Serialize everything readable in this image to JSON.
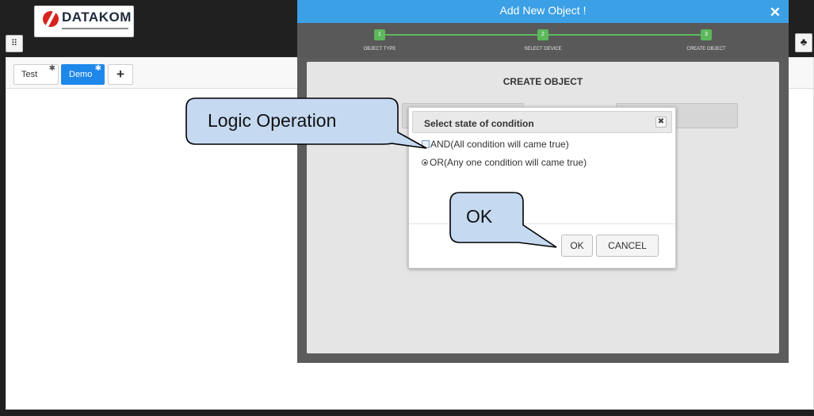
{
  "app": {
    "brand": "DATAKOM",
    "brand_sub": "DATAKOM ELECTRONIC ENGINEERING LTD. STI.",
    "apps_icon": "grid-icon",
    "tree_icon": "tree-icon"
  },
  "tabs": [
    {
      "label": "Test",
      "icon": "gear-icon",
      "active": false
    },
    {
      "label": "Demo",
      "icon": "gear-icon",
      "active": true
    }
  ],
  "add_tab": {
    "label": "+"
  },
  "modal": {
    "title": "Add New Object !",
    "close": "✕",
    "subtitle": "CREATE OBJECT",
    "steps": [
      {
        "number": "1",
        "label": "OBJECT TYPE"
      },
      {
        "number": "2",
        "label": "SELECT DEVICE"
      },
      {
        "number": "3",
        "label": "CREATE OBJECT"
      }
    ]
  },
  "dialog": {
    "title": "Select state of condition",
    "close": "✖",
    "options": [
      {
        "label": "AND(All condition will came true)",
        "control": "checkbox",
        "selected": false
      },
      {
        "label": "OR(Any one condition will came true)",
        "control": "radio",
        "selected": true
      }
    ],
    "ok_label": "OK",
    "cancel_label": "CANCEL"
  },
  "callouts": {
    "logic": "Logic Operation",
    "ok": "OK"
  },
  "colors": {
    "accent": "#3ba0e6",
    "tab_active": "#1e88ea",
    "step": "#5cb85c",
    "callout_fill": "#c5d9f1",
    "brand_red": "#d6241f"
  }
}
